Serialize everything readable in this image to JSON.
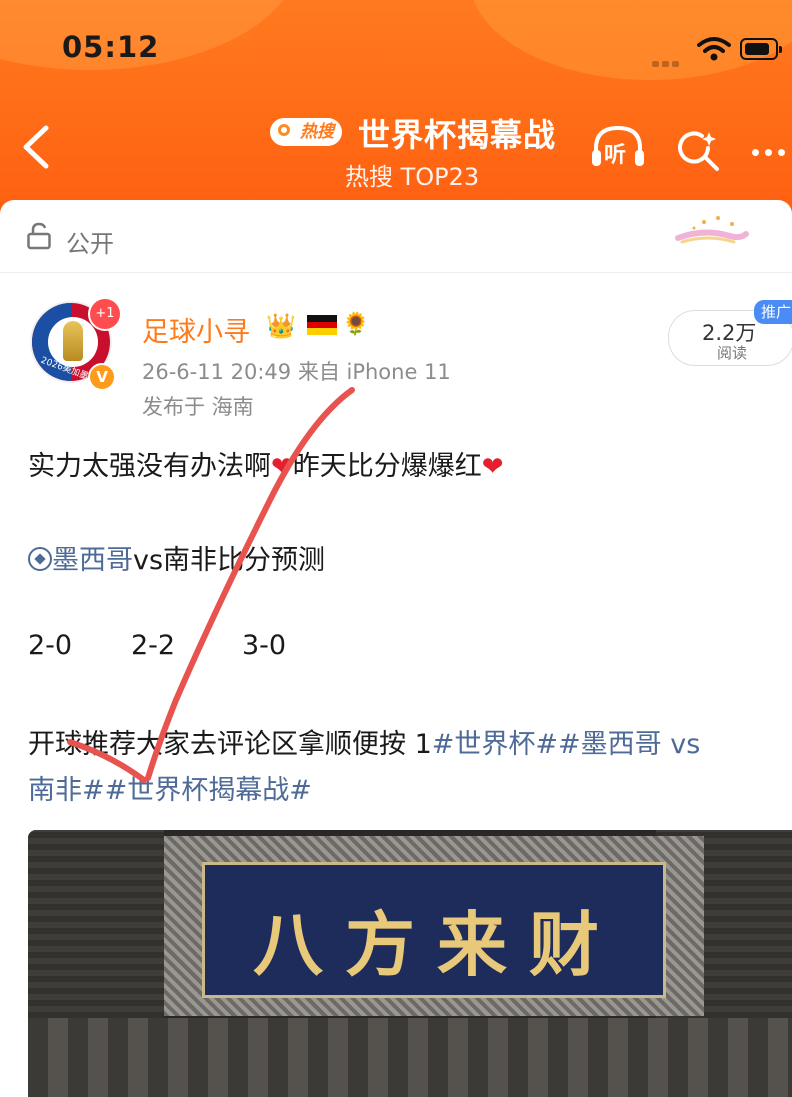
{
  "status_bar": {
    "time": "05:12"
  },
  "header": {
    "hot_badge": "热搜",
    "title": "世界杯揭幕战",
    "subtitle": "热搜 TOP23",
    "listen_label": "听"
  },
  "visibility": {
    "label": "公开"
  },
  "post": {
    "author": "足球小寻",
    "plus_badge": "+1",
    "verified_badge": "V",
    "avatar_ring_text": "2026美加墨",
    "meta": "26-6-11 20:49  来自 iPhone 11",
    "location": "发布于 海南",
    "read_count": "2.2万",
    "read_label": "阅读",
    "promo_badge": "推广",
    "line1_a": "实力太强没有办法啊",
    "line1_b": "昨天比分爆爆红",
    "line2_link": "墨西哥",
    "line2_rest": "vs南非比分预测",
    "scores": [
      "2-0",
      "2-2",
      "3-0"
    ],
    "line4_a": "开球推荐大家去评论区拿顺便按 1",
    "line4_tag1": "#世界杯#",
    "line4_tag2": "#墨西哥 vs",
    "line5_tag2_end": "南非#",
    "line5_tag3": "#世界杯揭幕战#"
  },
  "image": {
    "plaque_text": "八方来财"
  },
  "colors": {
    "header_orange": "#ff6c16",
    "link_blue": "#4e6b98",
    "username_orange": "#ff7a1a",
    "annotation_red": "#e8534f"
  },
  "icons": [
    "back-icon",
    "search-icon",
    "listen-icon",
    "more-icon",
    "lock-icon",
    "wifi-icon",
    "battery-icon",
    "crown-icon",
    "flag-germany-icon",
    "sunflower-icon",
    "heart-icon",
    "soccer-ball-icon"
  ]
}
